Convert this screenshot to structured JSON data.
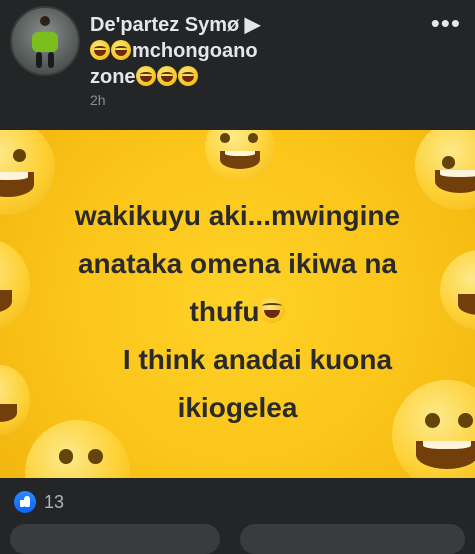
{
  "post": {
    "author_line1": "De'partez Symø ▶",
    "author_line2": "mchongoano",
    "author_line3": "zone",
    "time": "2h",
    "more_label": "•••"
  },
  "image": {
    "line1": "wakikuyu aki...mwingine",
    "line2": "anataka omena ikiwa na",
    "line3": "thufu",
    "line4": "I think anadai kuona",
    "line5": "ikiogelea"
  },
  "reactions": {
    "count": "13",
    "icon": "like-icon",
    "accent": "#0866ff"
  },
  "icons": {
    "emoji": "laughing-crying-emoji"
  }
}
